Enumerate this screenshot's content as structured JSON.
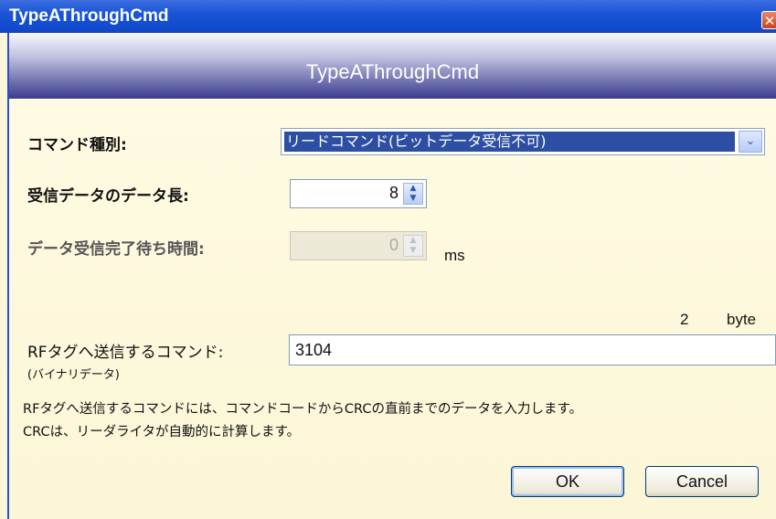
{
  "window": {
    "title": "TypeAThroughCmd",
    "close_glyph": "✕"
  },
  "header": {
    "title": "TypeAThroughCmd"
  },
  "command_type": {
    "label": "コマンド種別:",
    "selected": "リードコマンド(ビットデータ受信不可)",
    "arrow_glyph": "⌄"
  },
  "receive_length": {
    "label": "受信データのデータ長:",
    "value": "8"
  },
  "wait_time": {
    "label": "データ受信完了待ち時間:",
    "value": "0",
    "unit": "ms"
  },
  "command": {
    "byte_count": "2",
    "byte_unit": "byte",
    "label": "RFタグへ送信するコマンド:",
    "sublabel": "(バイナリデータ)",
    "value": "3104"
  },
  "info": {
    "line1": "RFタグへ送信するコマンドには、コマンドコードからCRCの直前までのデータを入力します。",
    "line2": "CRCは、リーダライタが自動的に計算します。"
  },
  "buttons": {
    "ok": "OK",
    "cancel": "Cancel"
  },
  "colors": {
    "titlebar": "#1a55d8",
    "selection": "#2d4fa3",
    "background": "#fbf6d9"
  }
}
